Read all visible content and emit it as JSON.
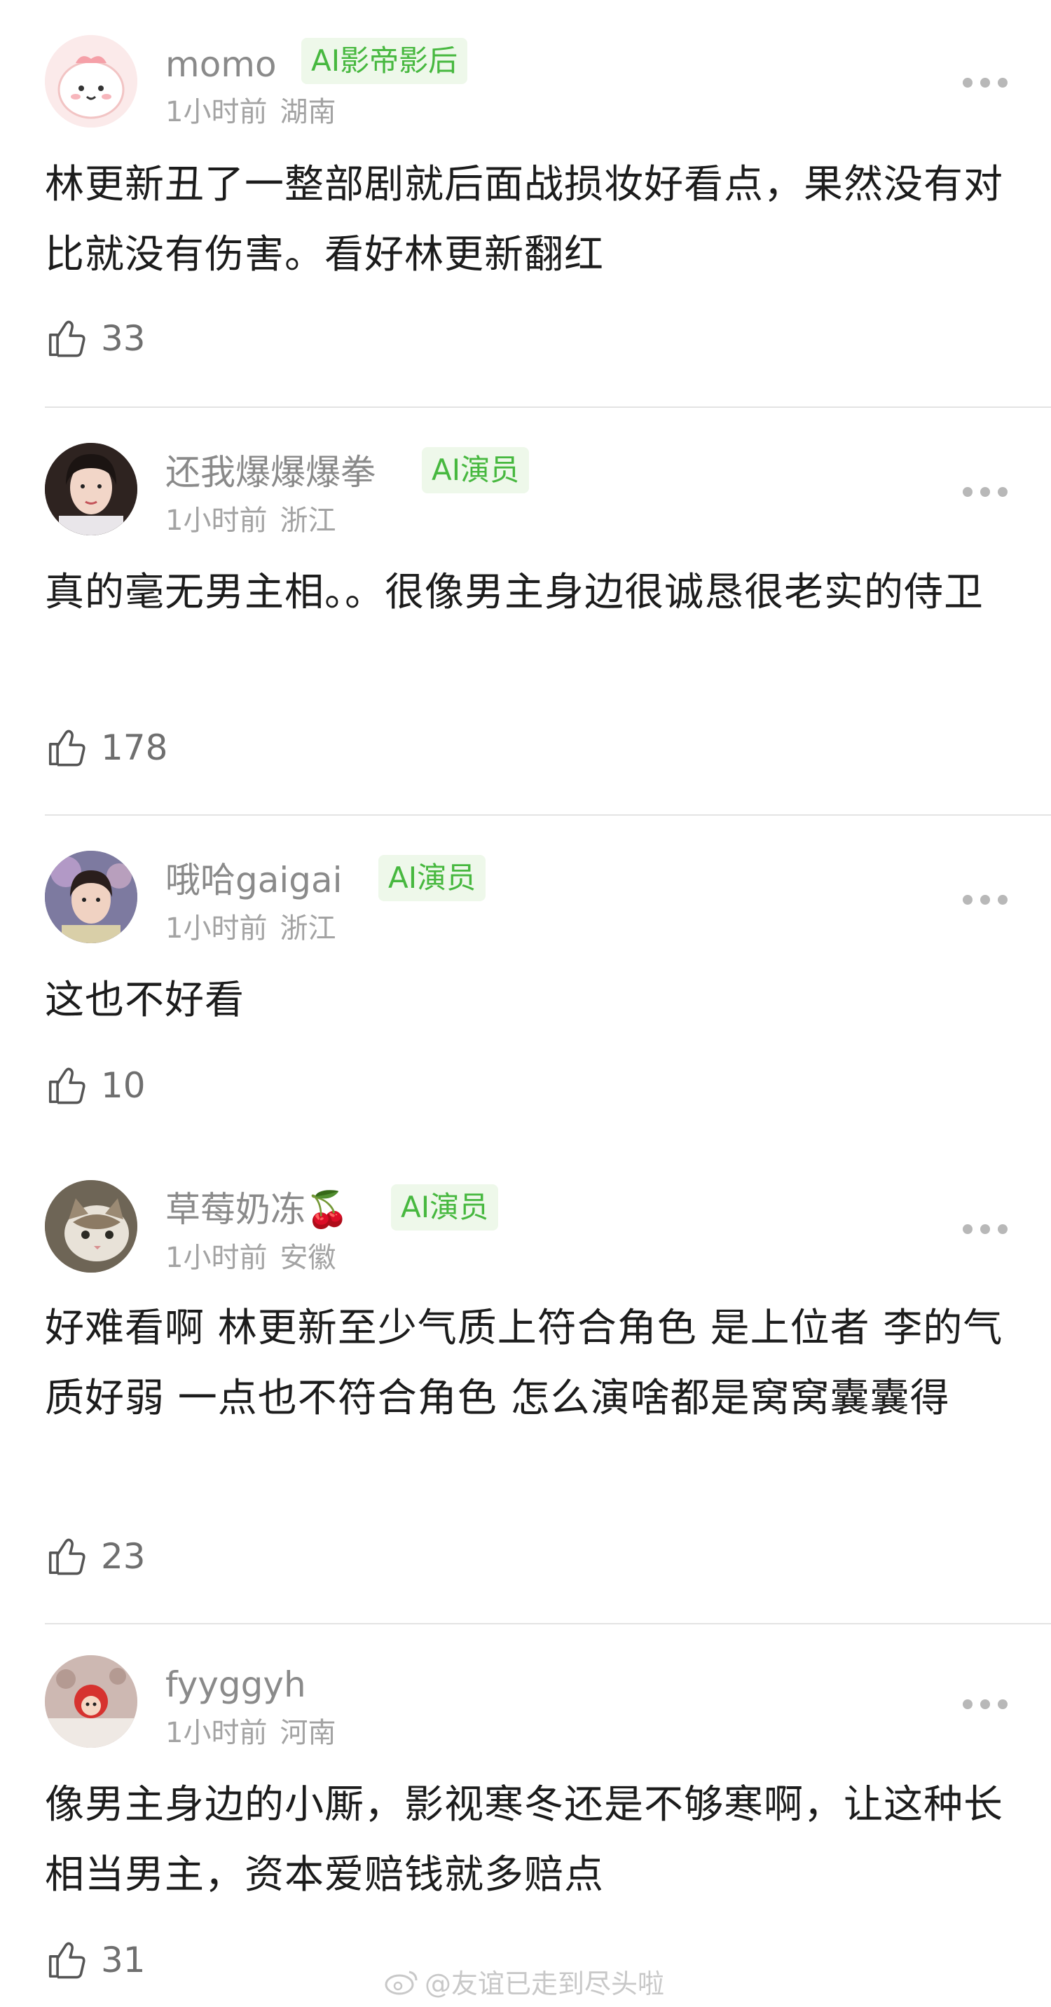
{
  "comments": [
    {
      "username": "momo",
      "badge": "AI影帝影后",
      "time": "1小时前",
      "location": "湖南",
      "text": "林更新丑了一整部剧就后面战损妆好看点，果然没有对比就没有伤害。看好林更新翻红",
      "likes": "33",
      "avatar_icon": "pink-cartoon-avatar",
      "avatar_color": "#f7dede"
    },
    {
      "username": "还我爆爆爆拳",
      "badge": "AI演员",
      "time": "1小时前",
      "location": "浙江",
      "text": "真的毫无男主相。。很像男主身边很诚恳很老实的侍卫",
      "likes": "178",
      "avatar_icon": "portrait-avatar",
      "avatar_color": "#3a2a24"
    },
    {
      "username": "哦哈gaigai",
      "badge": "AI演员",
      "time": "1小时前",
      "location": "浙江",
      "text": "这也不好看",
      "likes": "10",
      "avatar_icon": "portrait-avatar",
      "avatar_color": "#6b6a8a"
    },
    {
      "username": "草莓奶冻🍒",
      "badge": "AI演员",
      "time": "1小时前",
      "location": "安徽",
      "text": "好难看啊 林更新至少气质上符合角色 是上位者 李的气质好弱 一点也不符合角色 怎么演啥都是窝窝囊囊得",
      "likes": "23",
      "avatar_icon": "cat-avatar",
      "avatar_color": "#8a7a66"
    },
    {
      "username": "fyyggyh",
      "badge": "",
      "time": "1小时前",
      "location": "河南",
      "text": "像男主身边的小厮，影视寒冬还是不够寒啊，让这种长相当男主，资本爱赔钱就多赔点",
      "likes": "31",
      "avatar_icon": "red-cartoon-avatar",
      "avatar_color": "#d9c2bd"
    }
  ],
  "watermark": "@友谊已走到尽头啦",
  "colors": {
    "badge_bg": "#eef8ea",
    "badge_text": "#47b83f",
    "username": "#8a8a8a",
    "meta": "#a3a3a3"
  }
}
